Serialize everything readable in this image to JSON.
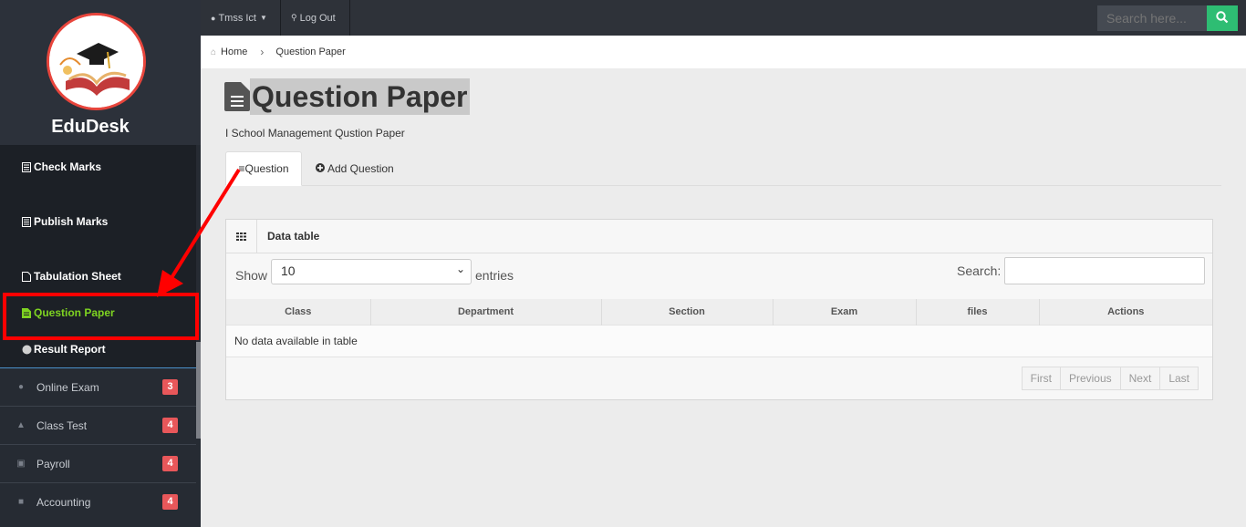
{
  "brand": {
    "name": "EduDesk"
  },
  "sidebar": {
    "submenu": [
      {
        "label": "Check Marks",
        "icon": "report-icon"
      },
      {
        "label": "Publish Marks",
        "icon": "report-icon"
      },
      {
        "label": "Tabulation Sheet",
        "icon": "file-icon"
      },
      {
        "label": "Question Paper",
        "icon": "file-text-icon",
        "active": true
      },
      {
        "label": "Result Report",
        "icon": "circle-icon"
      }
    ],
    "menu": [
      {
        "label": "Online Exam",
        "badge": "3",
        "icon": "info-icon"
      },
      {
        "label": "Class Test",
        "badge": "4",
        "icon": "graduation-cap-icon"
      },
      {
        "label": "Payroll",
        "badge": "4",
        "icon": "money-icon"
      },
      {
        "label": "Accounting",
        "badge": "4",
        "icon": "briefcase-icon"
      }
    ]
  },
  "topbar": {
    "user_label": "Tmss Ict",
    "logout_label": "Log Out",
    "search_placeholder": "Search here..."
  },
  "breadcrumb": {
    "home": "Home",
    "current": "Question Paper"
  },
  "page": {
    "title": "Question Paper",
    "subtitle": "I School Management Qustion Paper",
    "tabs": {
      "question": "Question",
      "add_question": "Add Question"
    }
  },
  "panel": {
    "title": "Data table",
    "show_label": "Show",
    "entries_value": "10",
    "entries_label": "entries",
    "search_label": "Search:",
    "columns": [
      "Class",
      "Department",
      "Section",
      "Exam",
      "files",
      "Actions"
    ],
    "empty_message": "No data available in table",
    "pagination": {
      "first": "First",
      "previous": "Previous",
      "next": "Next",
      "last": "Last"
    }
  },
  "colors": {
    "accent_green": "#2ebd73",
    "active_menu": "#7ed321",
    "badge": "#e8575a",
    "annotation": "#ff0000"
  }
}
